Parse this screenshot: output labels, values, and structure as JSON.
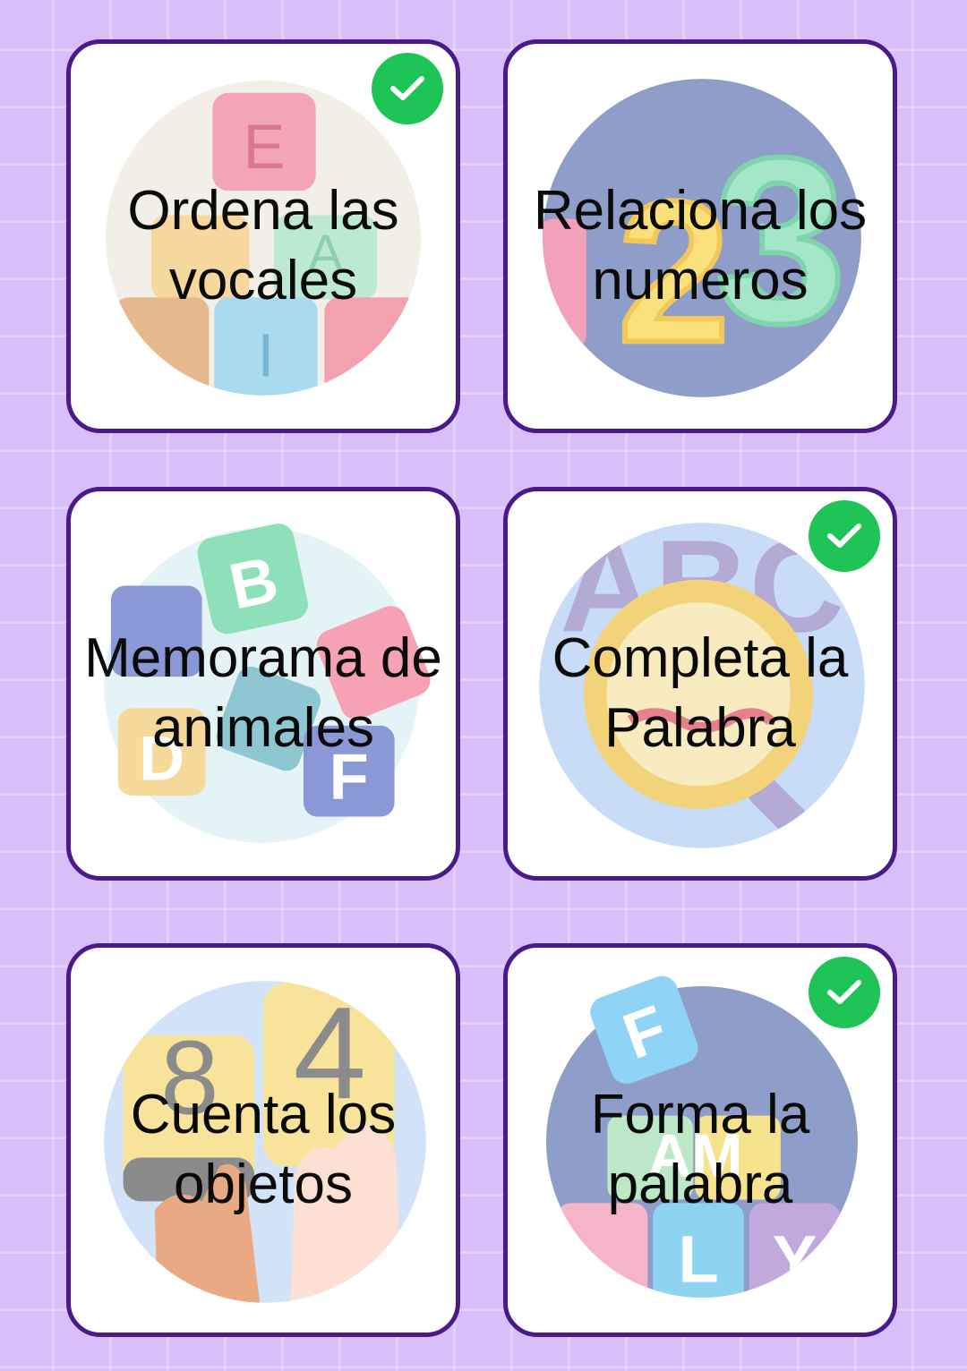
{
  "activities": [
    {
      "title": "Ordena las vocales",
      "completed": true,
      "illustration": "vowel-blocks-icon"
    },
    {
      "title": "Relaciona los numeros",
      "completed": false,
      "illustration": "numbers-123-icon"
    },
    {
      "title": "Memorama de animales",
      "completed": false,
      "illustration": "letter-blocks-icon"
    },
    {
      "title": "Completa la Palabra",
      "completed": true,
      "illustration": "abc-magnifier-icon"
    },
    {
      "title": "Cuenta los objetos",
      "completed": false,
      "illustration": "counting-hands-icon"
    },
    {
      "title": "Forma la palabra",
      "completed": true,
      "illustration": "word-blocks-icon"
    }
  ],
  "colors": {
    "background": "#d9bff9",
    "card_border": "#4a1a8a",
    "check_badge": "#1fc456"
  }
}
